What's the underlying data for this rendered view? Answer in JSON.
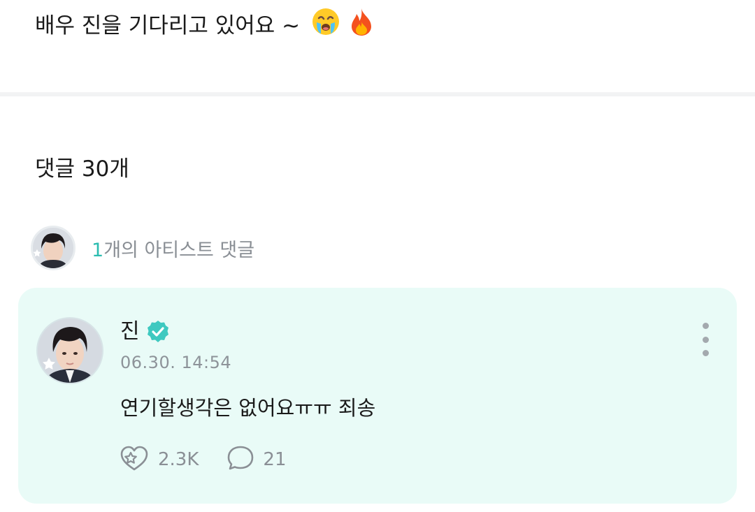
{
  "post": {
    "text": "배우 진을 기다리고 있어요 ~",
    "emojis": [
      "crying-face",
      "fire"
    ]
  },
  "comments_header": {
    "label": "댓글 30개"
  },
  "artist_comments": {
    "count": "1",
    "label_suffix": "개의 아티스트 댓글"
  },
  "comment": {
    "author": "진",
    "verified": true,
    "timestamp": "06.30. 14:54",
    "text": "연기할생각은 없어요ㅠㅠ 죄송",
    "likes": "2.3K",
    "replies": "21"
  },
  "colors": {
    "accent": "#2bbcb0",
    "card_bg": "#e9fbf7",
    "verified": "#3ec9c0",
    "muted": "#8a8f95"
  },
  "icons": {
    "more": "vertical-dots-icon",
    "like": "star-heart-icon",
    "reply": "speech-bubble-icon",
    "verified": "verified-badge-icon"
  }
}
